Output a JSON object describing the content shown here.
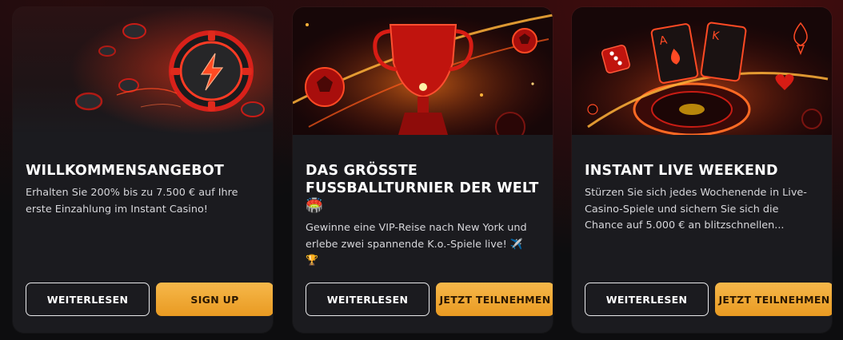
{
  "cards": [
    {
      "title": "WILLKOMMENSANGEBOT",
      "description": "Erhalten Sie 200% bis zu 7.500 € auf Ihre erste Einzahlung im Instant Casino!",
      "read_more_label": "WEITERLESEN",
      "cta_label": "SIGN UP",
      "image_icon": "poker-chip-lightning-icon"
    },
    {
      "title": "DAS GRÖSSTE FUSSBALLTURNIER DER WELT 🏟️",
      "description": "Gewinne eine VIP-Reise nach New York und erlebe zwei spannende K.o.-Spiele live! ✈️ 🏆",
      "read_more_label": "WEITERLESEN",
      "cta_label": "JETZT TEILNEHMEN",
      "image_icon": "trophy-football-icon"
    },
    {
      "title": "INSTANT LIVE WEEKEND",
      "description": "Stürzen Sie sich jedes Wochenende in Live-Casino-Spiele und sichern Sie sich die Chance auf 5.000 € an blitzschnellen...",
      "read_more_label": "WEITERLESEN",
      "cta_label": "JETZT TEILNEHMEN",
      "image_icon": "roulette-cards-dice-icon"
    }
  ],
  "colors": {
    "page_bg": "#0d0d0f",
    "card_bg": "#1b1b1f",
    "accent_gold": "#f6b84a",
    "accent_red": "#e0241c"
  }
}
